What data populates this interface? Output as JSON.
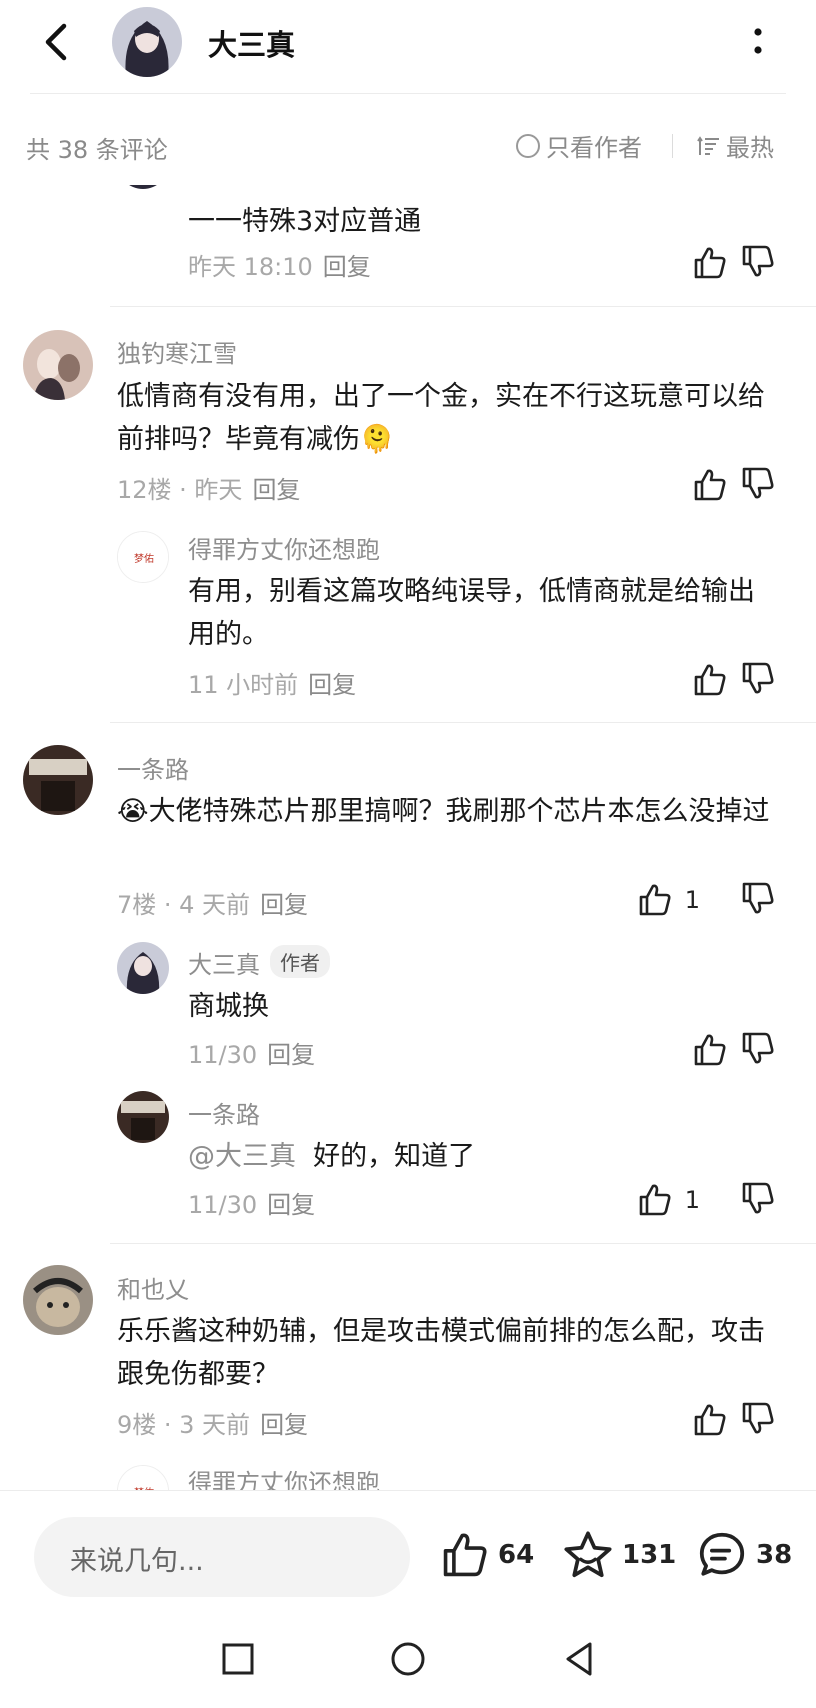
{
  "header": {
    "title": "大三真",
    "back_icon": "chevron-left-icon",
    "more_icon": "more-vertical-icon"
  },
  "subbar": {
    "count_label": "共 38 条评论",
    "author_only_label": "只看作者",
    "sort_label": "最热"
  },
  "comments": [
    {
      "text": "一一特殊3对应普通",
      "meta": "昨天 18:10",
      "reply_label": "回复"
    },
    {
      "user": "独钓寒江雪",
      "text": "低情商有没有用，出了一个金，实在不行这玩意可以给前排吗？毕竟有减伤",
      "emoji": "🫠",
      "meta": "12楼 · 昨天",
      "reply_label": "回复"
    },
    {
      "user": "得罪方丈你还想跑",
      "avatar_text": "梦佑",
      "text": "有用，别看这篇攻略纯误导，低情商就是给输出用的。",
      "meta": "11 小时前",
      "reply_label": "回复"
    },
    {
      "user": "一条路",
      "emoji": "😭",
      "text": "大佬特殊芯片那里搞啊？我刷那个芯片本怎么没掉过",
      "meta": "7楼 · 4 天前",
      "reply_label": "回复",
      "likes": "1"
    },
    {
      "user": "大三真",
      "badge": "作者",
      "text": "商城换",
      "meta": "11/30",
      "reply_label": "回复"
    },
    {
      "user": "一条路",
      "mention": "@大三真",
      "text": "好的，知道了",
      "meta": "11/30",
      "reply_label": "回复",
      "likes": "1"
    },
    {
      "user": "和也乂",
      "text": "乐乐酱这种奶辅，但是攻击模式偏前排的怎么配，攻击跟免伤都要？",
      "meta": "9楼 · 3 天前",
      "reply_label": "回复"
    },
    {
      "user": "得罪方丈你还想跑",
      "avatar_text": "梦佑"
    }
  ],
  "bottom": {
    "input_placeholder": "来说几句...",
    "likes": "64",
    "favorites": "131",
    "comments": "38"
  },
  "colors": {
    "text": "#1a1a1a",
    "muted": "#8e8e8e",
    "divider": "#ececec"
  }
}
